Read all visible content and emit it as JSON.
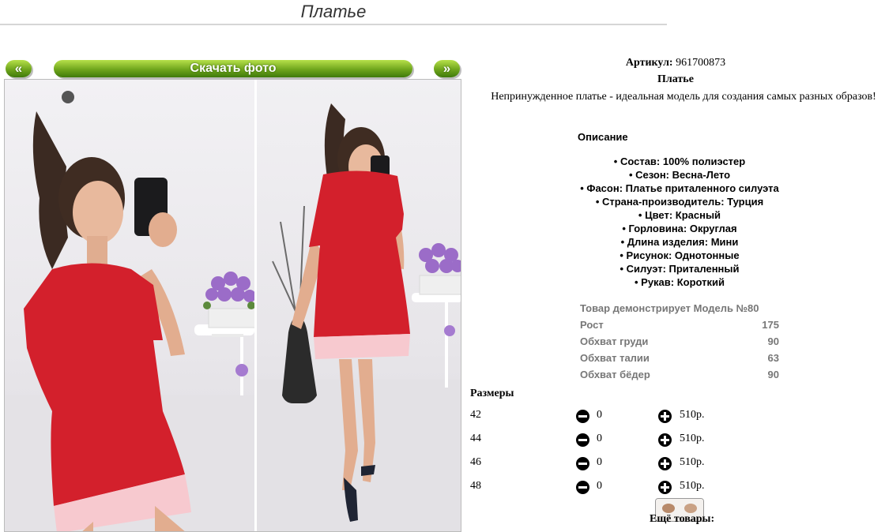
{
  "page": {
    "title": "Платье"
  },
  "gallery": {
    "prev_label": "«",
    "next_label": "»",
    "download_label": "Скачать фото"
  },
  "product": {
    "sku_label": "Артикул:",
    "sku_value": "961700873",
    "name": "Платье",
    "description": "Непринужденное платье - идеальная модель для создания самых разных образов!"
  },
  "description": {
    "heading": "Описание",
    "items": [
      "• Состав: 100% полиэстер",
      "• Сезон: Весна-Лето",
      "• Фасон: Платье приталенного силуэта",
      "• Страна-производитель: Турция",
      "• Цвет: Красный",
      "• Горловина: Округлая",
      "• Длина изделия: Мини",
      "• Рисунок: Однотонные",
      "• Силуэт: Приталенный",
      "• Рукав: Короткий"
    ]
  },
  "model": {
    "rows": [
      {
        "label": "Товар демонстрирует Модель №80",
        "value": ""
      },
      {
        "label": "Рост",
        "value": "175"
      },
      {
        "label": "Обхват груди",
        "value": "90"
      },
      {
        "label": "Обхват талии",
        "value": "63"
      },
      {
        "label": "Обхват бёдер",
        "value": "90"
      }
    ]
  },
  "sizes": {
    "heading": "Размеры",
    "rows": [
      {
        "size": "42",
        "qty": "0",
        "price": "510р."
      },
      {
        "size": "44",
        "qty": "0",
        "price": "510р."
      },
      {
        "size": "46",
        "qty": "0",
        "price": "510р."
      },
      {
        "size": "48",
        "qty": "0",
        "price": "510р."
      }
    ]
  },
  "more": {
    "heading": "Ещё товары:"
  },
  "colors": {
    "button_green": "#6fa51c",
    "dress_red": "#d3202c",
    "hem_pink": "#f7c9cf",
    "muted_text": "#777777"
  }
}
